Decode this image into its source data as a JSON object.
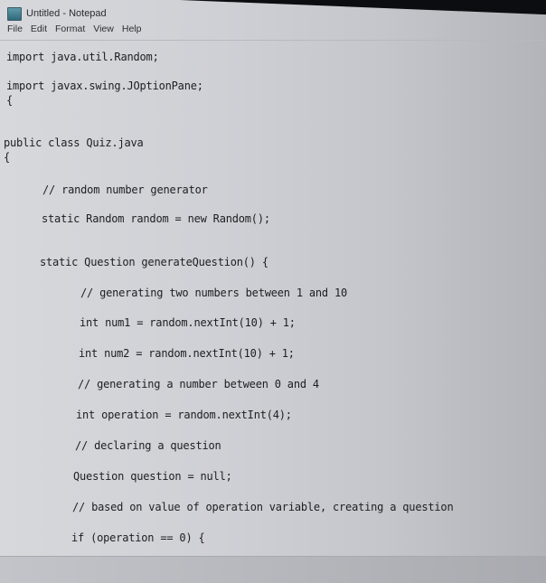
{
  "window": {
    "title": "Untitled - Notepad",
    "icon": "notepad-icon"
  },
  "menubar": {
    "items": [
      "File",
      "Edit",
      "Format",
      "View",
      "Help"
    ]
  },
  "editor": {
    "lines": [
      "import java.util.Random;",
      "import javax.swing.JOptionPane;",
      "{",
      "public class Quiz.java",
      "{",
      "// random number generator",
      "static Random random = new Random();",
      "static Question generateQuestion() {",
      "// generating two numbers between 1 and 10",
      "int num1 = random.nextInt(10) + 1;",
      "int num2 = random.nextInt(10) + 1;",
      "// generating a number between 0 and 4",
      "int operation = random.nextInt(4);",
      "// declaring a question",
      "Question question = null;",
      "// based on value of operation variable, creating a question",
      "if (operation == 0) {"
    ]
  }
}
